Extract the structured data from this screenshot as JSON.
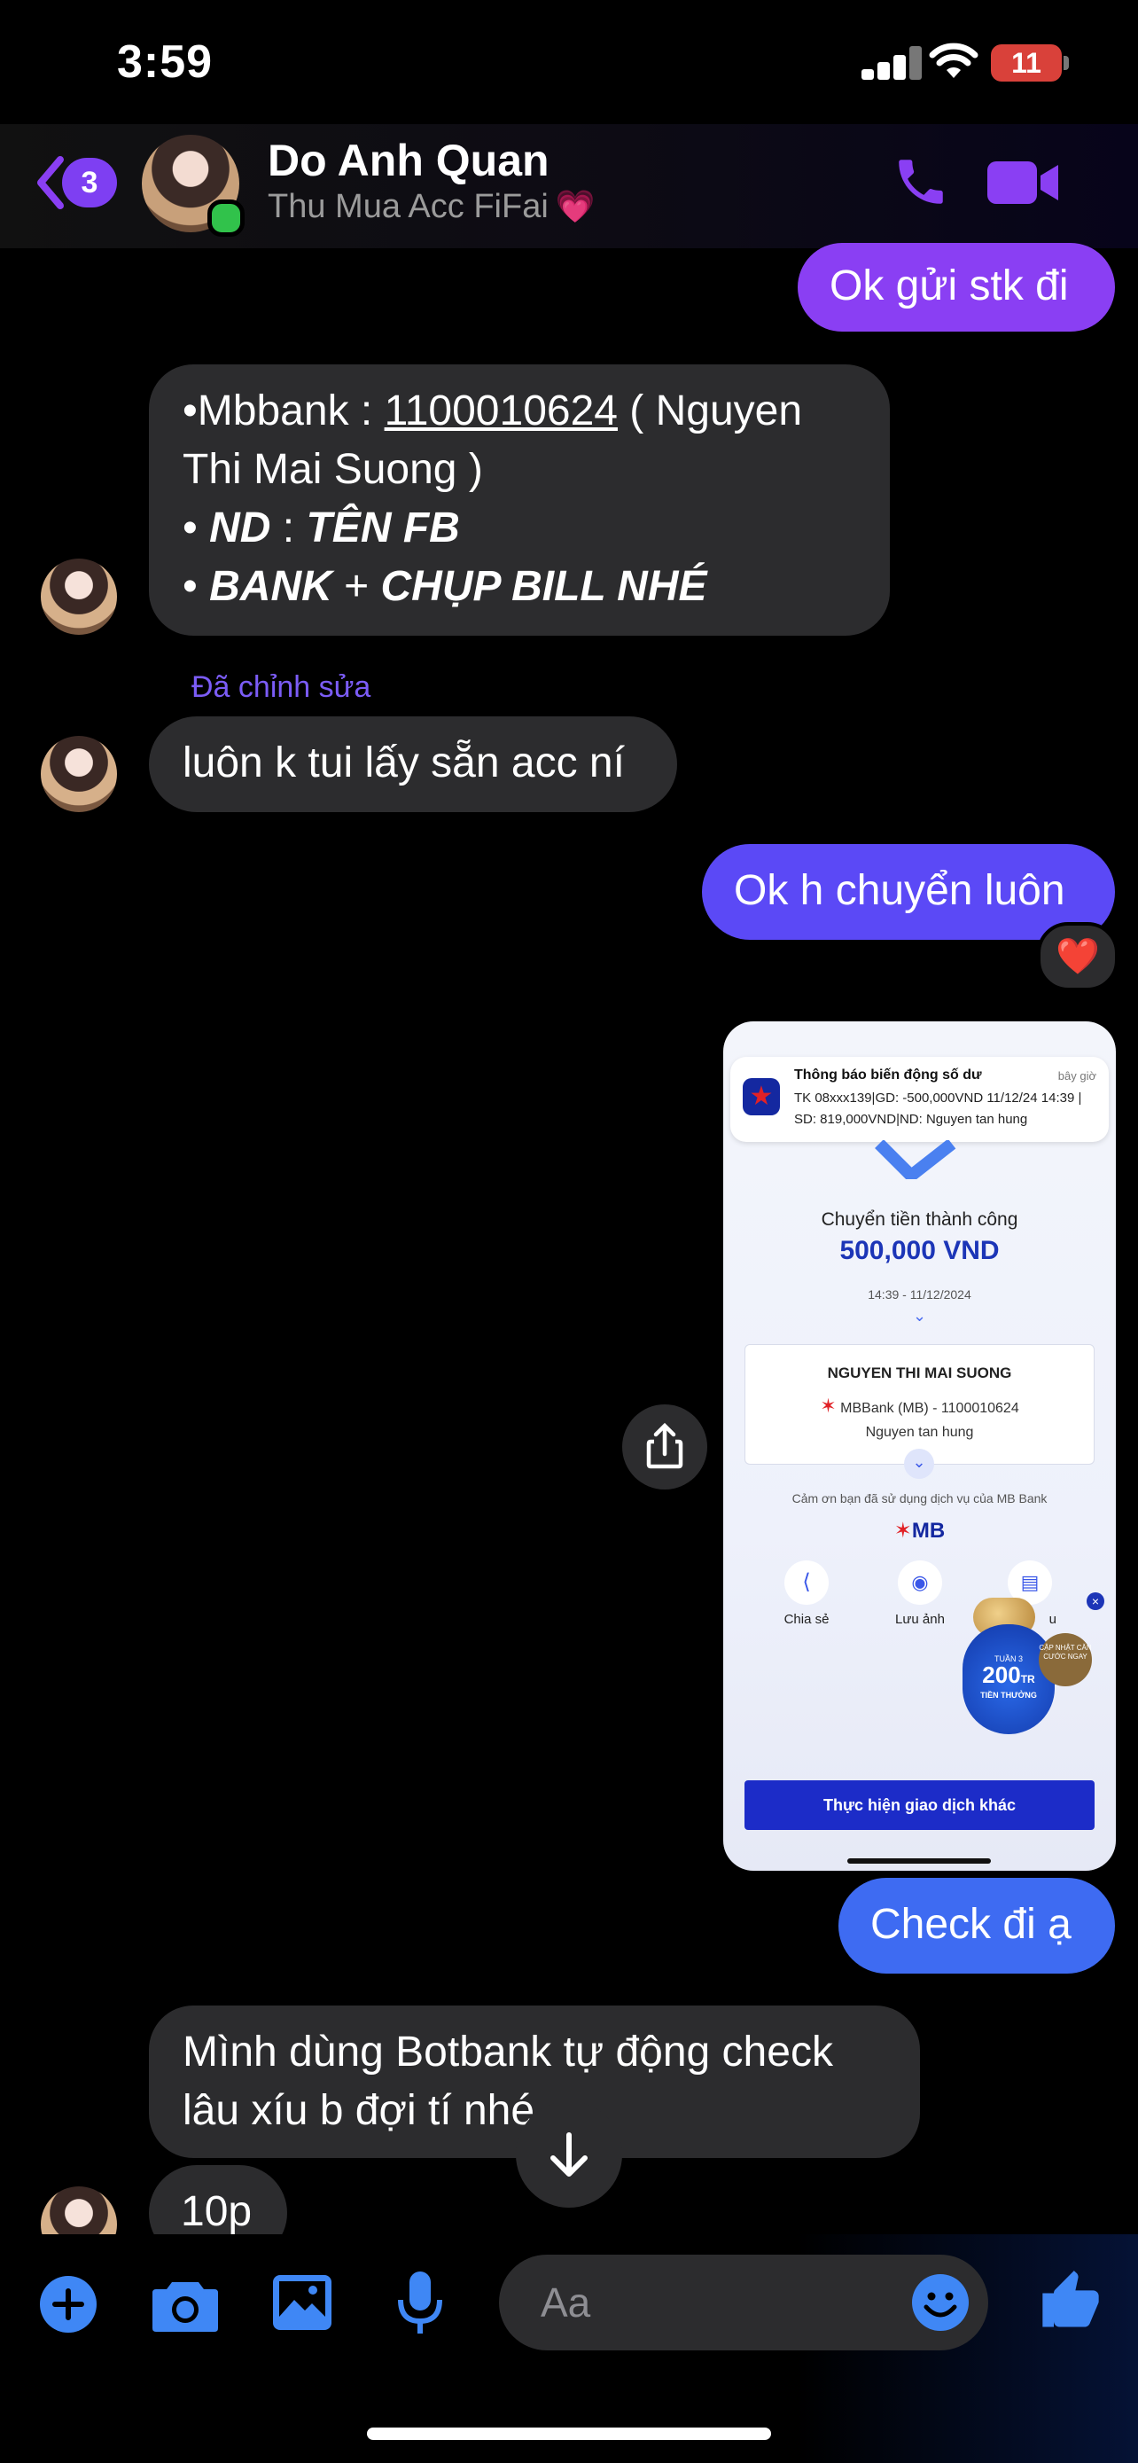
{
  "status_bar": {
    "time": "3:59",
    "battery": "11"
  },
  "header": {
    "unread_count": "3",
    "contact_name": "Do Anh Quan",
    "contact_status": "Thu Mua Acc FiFai",
    "status_emoji": "💗"
  },
  "messages": {
    "m1": "Ok gửi stk đi",
    "m2": {
      "line1_prefix": "•Mbbank : ",
      "account_number": "1100010624",
      "line1_suffix": " ( Nguyen",
      "line2": "Thi Mai Suong )",
      "line3_prefix": "• ",
      "line3_bold": "ND",
      "line3_mid": " : ",
      "line3_bold2": "TÊN FB",
      "line4_prefix": "• ",
      "line4_bold": "BANK",
      "line4_mid": " + ",
      "line4_bold2": "CHỤP BILL NHÉ"
    },
    "edited_label": "Đã chỉnh sửa",
    "m3": "luôn k tui lấy sẵn acc ní",
    "m4": "Ok h chuyển luôn",
    "m4_reaction": "❤️",
    "m5": "Check đi ạ",
    "m6_line1": "Mình dùng Botbank tự động check",
    "m6_line2": "lâu xíu b đợi tí nhé",
    "m7": "10p"
  },
  "receipt": {
    "notif_title": "Thông báo biến động số dư",
    "notif_time": "bây giờ",
    "notif_line1": "TK 08xxx139|GD: -500,000VND 11/12/24 14:39 |",
    "notif_line2": "SD: 819,000VND|ND: Nguyen tan hung",
    "success_label": "Chuyển tiền thành công",
    "amount": "500,000 VND",
    "datetime": "14:39 - 11/12/2024",
    "recipient_name": "NGUYEN THI MAI SUONG",
    "recipient_bank": "MBBank (MB) - 1100010624",
    "recipient_note": "Nguyen tan hung",
    "thanks": "Cảm ơn bạn đã sử dụng dịch vụ của MB Bank",
    "mb_logo": "MB",
    "action_share": "Chia sẻ",
    "action_save": "Lưu ảnh",
    "action_third": "u",
    "promo_week": "TUẦN 3",
    "promo_amount": "200",
    "promo_unit": "TR",
    "promo_label": "TIỀN THƯỞNG",
    "promo_badge": "CẬP NHẬT CĂN CƯỚC NGAY",
    "button": "Thực hiện giao dịch khác"
  },
  "composer": {
    "placeholder": "Aa"
  },
  "colors": {
    "accent_purple": "#8a3ff3",
    "bubble_indigo": "#5b49f6",
    "bubble_blue": "#3e6bf2",
    "incoming_bubble": "#2c2c2e",
    "composer_icons": "#3f87f5",
    "mb_primary": "#1428a0"
  },
  "icons": [
    "back-chevron-icon",
    "phone-icon",
    "video-icon",
    "share-icon",
    "arrow-down-icon",
    "plus-icon",
    "camera-icon",
    "image-icon",
    "mic-icon",
    "emoji-icon",
    "thumbs-up-icon"
  ]
}
